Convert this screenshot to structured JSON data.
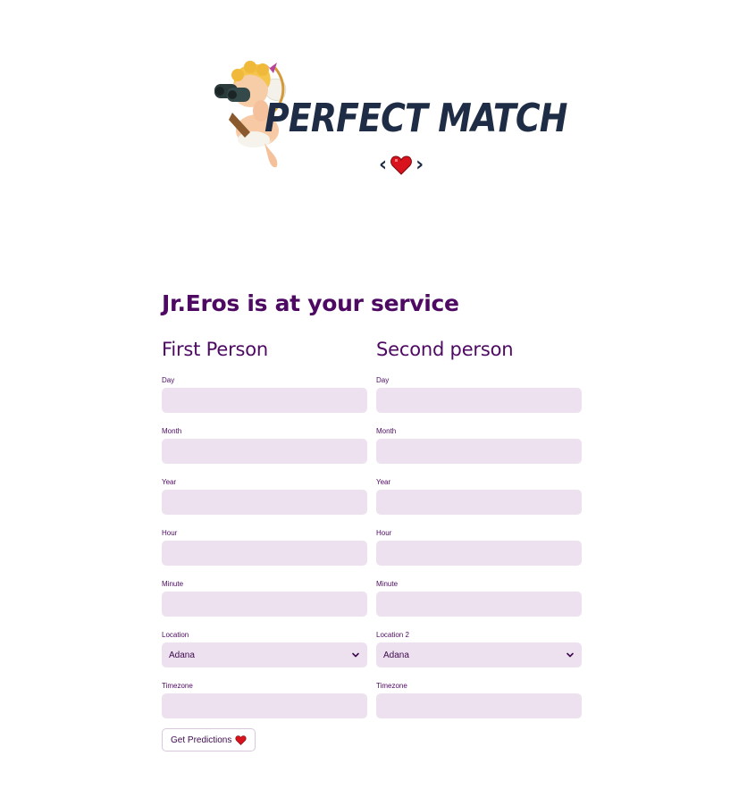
{
  "brand": {
    "logo_text": "PERFECT MATCH",
    "logo_icons": [
      "cupid-with-binoculars-icon",
      "heart-icon"
    ],
    "colors": {
      "logo_text": "#1e2d45",
      "heart": "#d8131d",
      "accent_purple": "#4e0a63",
      "input_bg": "#ede1ef"
    }
  },
  "header": {
    "title": "Jr.Eros is at your service"
  },
  "first_person": {
    "title": "First Person",
    "fields": {
      "day": {
        "label": "Day",
        "value": ""
      },
      "month": {
        "label": "Month",
        "value": ""
      },
      "year": {
        "label": "Year",
        "value": ""
      },
      "hour": {
        "label": "Hour",
        "value": ""
      },
      "minute": {
        "label": "Minute",
        "value": ""
      },
      "location": {
        "label": "Location",
        "value": "Adana"
      },
      "timezone": {
        "label": "Timezone",
        "value": ""
      }
    }
  },
  "second_person": {
    "title": "Second person",
    "fields": {
      "day": {
        "label": "Day",
        "value": ""
      },
      "month": {
        "label": "Month",
        "value": ""
      },
      "year": {
        "label": "Year",
        "value": ""
      },
      "hour": {
        "label": "Hour",
        "value": ""
      },
      "minute": {
        "label": "Minute",
        "value": ""
      },
      "location": {
        "label": "Location 2",
        "value": "Adana"
      },
      "timezone": {
        "label": "Timezone",
        "value": ""
      }
    }
  },
  "actions": {
    "predict_label": "Get Predictions",
    "predict_icon": "heart-icon"
  }
}
